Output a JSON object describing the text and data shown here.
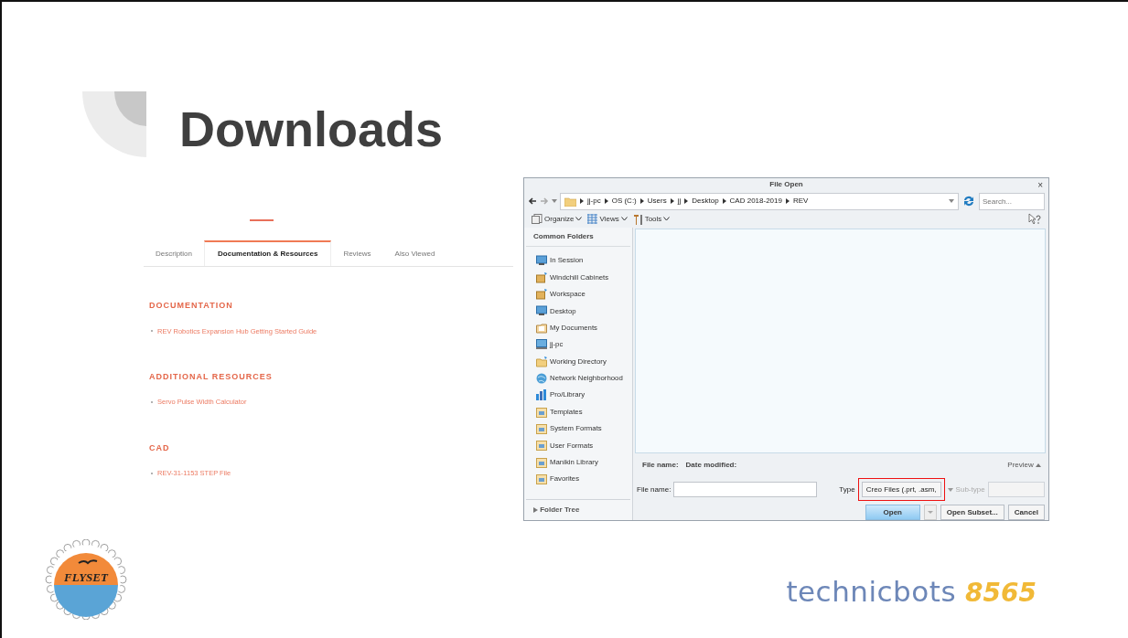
{
  "slide": {
    "title": "Downloads"
  },
  "web_page": {
    "tabs": [
      {
        "label": "Description",
        "selected": false
      },
      {
        "label": "Documentation & Resources",
        "selected": true
      },
      {
        "label": "Reviews",
        "selected": false
      },
      {
        "label": "Also Viewed",
        "selected": false
      }
    ],
    "sections": [
      {
        "heading": "DOCUMENTATION",
        "links": [
          "REV Robotics Expansion Hub Getting Started Guide"
        ]
      },
      {
        "heading": "ADDITIONAL RESOURCES",
        "links": [
          "Servo Pulse Width Calculator"
        ]
      },
      {
        "heading": "CAD",
        "links": [
          "REV-31-1153 STEP File"
        ]
      }
    ]
  },
  "file_dialog": {
    "title": "File Open",
    "close": "×",
    "breadcrumb": [
      "jj-pc",
      "OS (C:)",
      "Users",
      "jj",
      "Desktop",
      "CAD 2018-2019",
      "REV"
    ],
    "search": {
      "placeholder": "Search..."
    },
    "toolbar": [
      "Organize",
      "Views",
      "Tools"
    ],
    "sidebar": {
      "heading": "Common Folders",
      "items": [
        {
          "label": "In Session",
          "kind": "monitor"
        },
        {
          "label": "Windchill Cabinets",
          "kind": "cabinet"
        },
        {
          "label": "Workspace",
          "kind": "cabinet"
        },
        {
          "label": "Desktop",
          "kind": "monitor"
        },
        {
          "label": "My Documents",
          "kind": "documents"
        },
        {
          "label": "jj-pc",
          "kind": "computer"
        },
        {
          "label": "Working Directory",
          "kind": "folder"
        },
        {
          "label": "Network Neighborhood",
          "kind": "globe"
        },
        {
          "label": "Pro/Library",
          "kind": "library"
        },
        {
          "label": "Templates",
          "kind": "folder-box"
        },
        {
          "label": "System Formats",
          "kind": "folder-box"
        },
        {
          "label": "User Formats",
          "kind": "folder-box"
        },
        {
          "label": "Manikin Library",
          "kind": "folder-box"
        },
        {
          "label": "Favorites",
          "kind": "folder-box"
        }
      ],
      "footer": "Folder Tree"
    },
    "details": [
      "File name:",
      "Date modified:"
    ],
    "preview": "Preview",
    "file_name": {
      "label": "File name:"
    },
    "type": {
      "label": "Type",
      "value": "Creo Files (.prt, .asm,",
      "highlighted": true
    },
    "subtype": {
      "label": "Sub-type"
    },
    "buttons": [
      {
        "label": "Open",
        "default": true
      },
      {
        "label": "Open Subset...",
        "default": false
      },
      {
        "label": "Cancel",
        "default": false
      }
    ]
  },
  "logos": {
    "left": "FLYSET",
    "right_word": "technicbots",
    "right_number": "8565"
  }
}
